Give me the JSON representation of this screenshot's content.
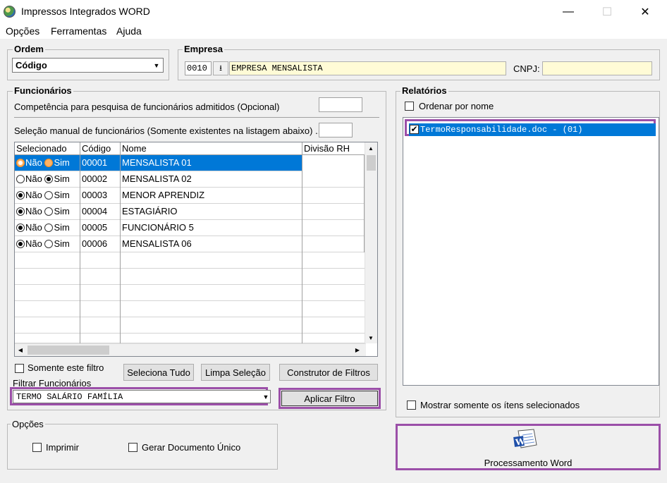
{
  "window": {
    "title": "Impressos Integrados WORD",
    "controls": {
      "minimize": "—",
      "maximize": "☐",
      "close": "✕"
    }
  },
  "menu": [
    "Opções",
    "Ferramentas",
    "Ajuda"
  ],
  "ordem": {
    "title": "Ordem",
    "selected": "Código"
  },
  "empresa": {
    "title": "Empresa",
    "code": "0010",
    "name": "EMPRESA MENSALISTA",
    "cnpj_label": "CNPJ:",
    "cnpj_value": ""
  },
  "funcionarios": {
    "title": "Funcionários",
    "competencia_label": "Competência para pesquisa de funcionários admitidos (Opcional)",
    "competencia_value": "",
    "selecao_label": "Seleção manual de funcionários (Somente existentes na listagem abaixo) ...",
    "selecao_value": "",
    "columns": [
      "Selecionado",
      "Código",
      "Nome",
      "Divisão RH"
    ],
    "radio_labels": {
      "no": "Não",
      "yes": "Sim"
    },
    "rows": [
      {
        "selected": "Não",
        "codigo": "00001",
        "nome": "MENSALISTA 01",
        "divisao": ""
      },
      {
        "selected": "Sim",
        "codigo": "00002",
        "nome": "MENSALISTA 02",
        "divisao": ""
      },
      {
        "selected": "Não",
        "codigo": "00003",
        "nome": "MENOR APRENDIZ",
        "divisao": ""
      },
      {
        "selected": "Não",
        "codigo": "00004",
        "nome": "ESTAGIÁRIO",
        "divisao": ""
      },
      {
        "selected": "Não",
        "codigo": "00005",
        "nome": "FUNCIONÁRIO 5",
        "divisao": ""
      },
      {
        "selected": "Não",
        "codigo": "00006",
        "nome": "MENSALISTA 06",
        "divisao": ""
      }
    ],
    "somente_filtro_label": "Somente este filtro",
    "somente_filtro_checked": false,
    "buttons": {
      "seleciona_tudo": "Seleciona Tudo",
      "limpa_selecao": "Limpa Seleção",
      "construtor": "Construtor de Filtros"
    },
    "filtrar_label": "Filtrar Funcionários",
    "filtro_selected": "TERMO SALÁRIO FAMÍLIA",
    "aplicar_label": "Aplicar Filtro"
  },
  "opcoes": {
    "title": "Opções",
    "imprimir_label": "Imprimir",
    "imprimir_checked": false,
    "gerar_label": "Gerar Documento Único",
    "gerar_checked": false
  },
  "relatorios": {
    "title": "Relatórios",
    "ordenar_label": "Ordenar por nome",
    "ordenar_checked": false,
    "items": [
      {
        "label": "TermoResponsabilidade.doc - (01)",
        "checked": true
      }
    ],
    "mostrar_label": "Mostrar somente os ítens selecionados",
    "mostrar_checked": false
  },
  "processar": {
    "label": "Processamento Word"
  },
  "colors": {
    "selection": "#0078d7",
    "highlight_border": "#9b4fa8",
    "field_yellow": "#fffbd6"
  }
}
